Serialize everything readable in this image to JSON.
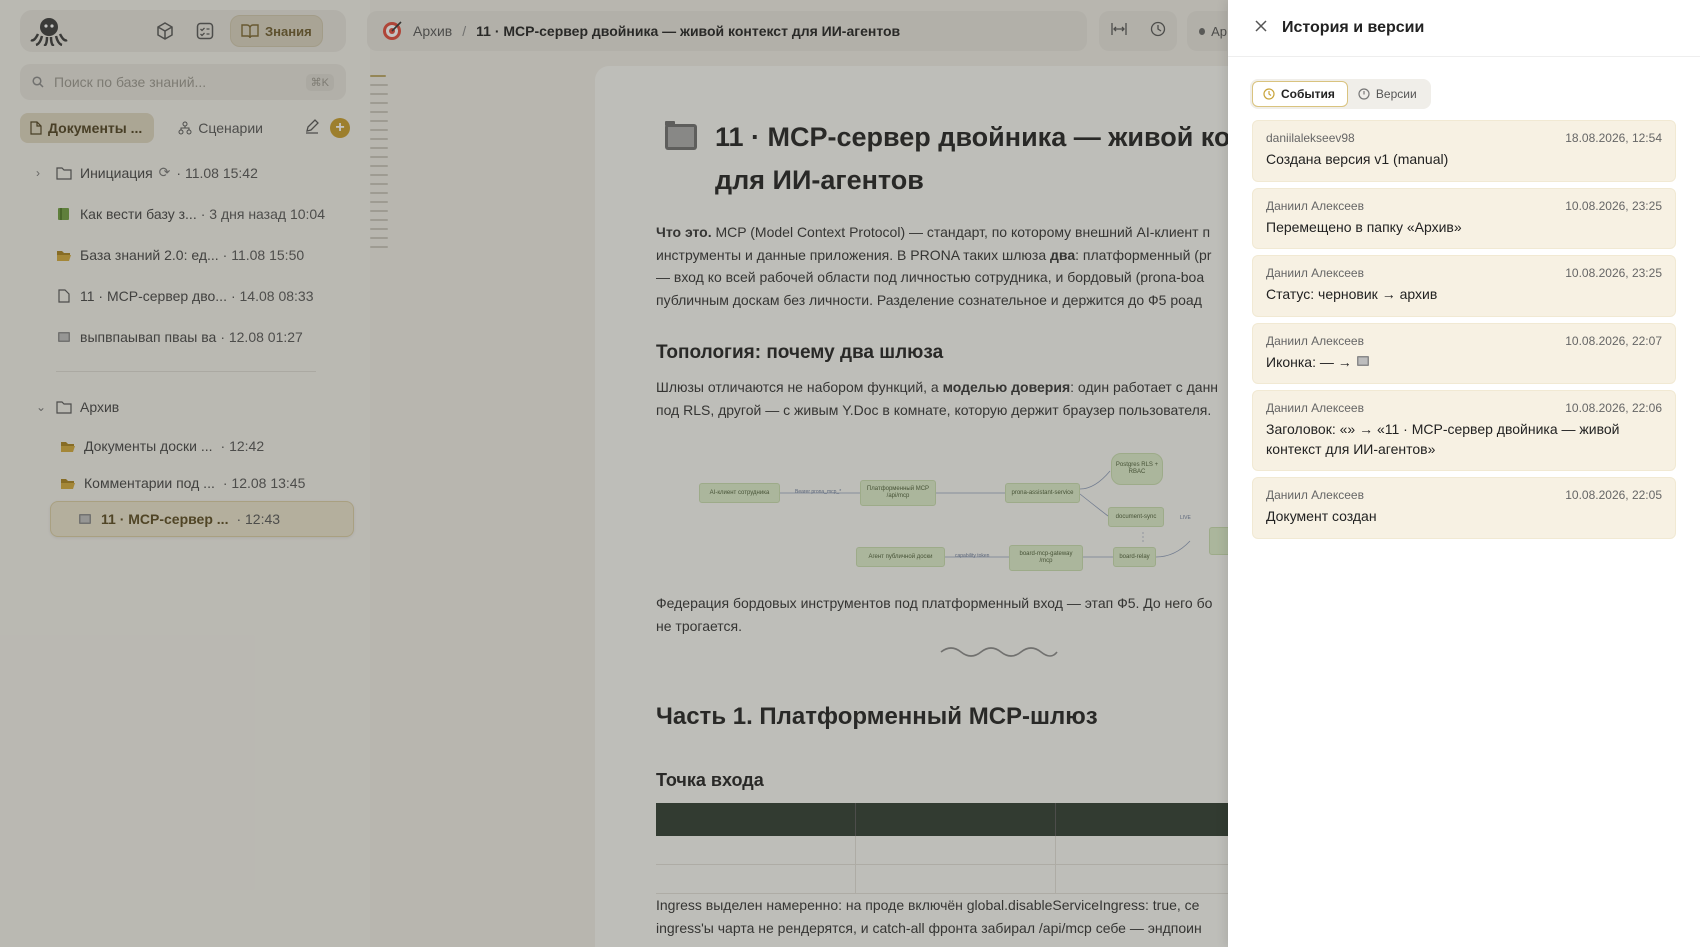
{
  "app": {
    "knowledge_label": "Знания",
    "search_placeholder": "Поиск по базе знаний...",
    "search_shortcut": "⌘K"
  },
  "sidebar": {
    "tab_docs": "Документы ...",
    "tab_scenarios": "Сценарии",
    "tree": [
      {
        "label": "Инициация",
        "meta": "· 11.08 15:42",
        "type": "folder"
      },
      {
        "label": "Как вести базу з...",
        "meta": "· 3 дня назад 10:04",
        "type": "book"
      },
      {
        "label": "База знаний 2.0: ед...",
        "meta": "· 11.08 15:50",
        "type": "folder-open"
      },
      {
        "label": "11 · MCP-сервер дво...",
        "meta": "· 14.08 08:33",
        "type": "doc"
      },
      {
        "label": "выпвпаывап пвaы ва",
        "meta": "· 12.08 01:27",
        "type": "board"
      }
    ],
    "archive": {
      "label": "Архив",
      "items": [
        {
          "label": "Документы доски ...",
          "meta": "· 12:42"
        },
        {
          "label": "Комментарии под ...",
          "meta": "· 12.08 13:45"
        },
        {
          "label": "11 · MCP-сервер ...",
          "meta": "· 12:43"
        }
      ]
    }
  },
  "breadcrumb": {
    "archive": "Архив",
    "separator": "/",
    "title": "11 · MCP-сервер двойника — живой контекст для ИИ-агентов"
  },
  "header_right": {
    "status_short": "Ар"
  },
  "document": {
    "title_line1": "11 · MCP-сервер двойника — живой ко",
    "title_line2": "для ИИ-агентов",
    "intro": {
      "bold": "Что это.",
      "line1": " MCP (Model Context Protocol) — стандарт, по которому внешний AI-клиент п",
      "line2a": "инструменты и данные приложения. В PRONA таких шлюза ",
      "line2bold": "два",
      "line2b": ": платформенный (pr",
      "line3": "— вход ко всей рабочей области под личностью сотрудника, и бордовый (prona-boa",
      "line4": "публичным доскам без личности. Разделение сознательное и держится до Ф5 роад"
    },
    "h_topology": "Топология: почему два шлюза",
    "topology": {
      "line1a": "Шлюзы отличаются не набором функций, а ",
      "line1bold": "моделью доверия",
      "line1b": ": один работает с данн",
      "line2": "под RLS, другой — с живым Y.Doc в комнате, которую держит браузер пользователя."
    },
    "diagram": {
      "n1": "AI-клиент сотрудника",
      "e1": "Bearer prona_mcp_*",
      "n2": "Платформенный MCP /api/mcp",
      "n3": "prona-assistant-service",
      "n4": "Postgres RLS + RBAC",
      "n5": "document-sync",
      "n6": "Агент публичной доски",
      "e2": "capability token",
      "n7": "board-mcp-gateway /mcp",
      "n8": "board-relay",
      "e3": "LIVE"
    },
    "federation_line1": "Федерация бордовых инструментов под платформенный вход — этап Ф5. До него бо",
    "federation_line2": "не трогается.",
    "h_part1": "Часть 1. Платформенный MCP-шлюз",
    "h_entry": "Точка входа",
    "ingress_line1": "Ingress выделен намеренно: на проде включён global.disableServiceIngress: true, се",
    "ingress_line2": "ingress'ы чарта не рендерятся, и catch-all фронта забирал /api/mcp себе — эндпоин"
  },
  "panel": {
    "title": "История и версии",
    "tab_events": "События",
    "tab_versions": "Версии",
    "events": [
      {
        "author": "daniilalekseev98",
        "date": "18.08.2026, 12:54",
        "text": "Создана версия v1 (manual)"
      },
      {
        "author": "Даниил Алексеев",
        "date": "10.08.2026, 23:25",
        "text": "Перемещено в папку «Архив»"
      },
      {
        "author": "Даниил Алексеев",
        "date": "10.08.2026, 23:25",
        "text": "Статус: черновик → архив"
      },
      {
        "author": "Даниил Алексеев",
        "date": "10.08.2026, 22:07",
        "text": "Иконка: — →"
      },
      {
        "author": "Даниил Алексеев",
        "date": "10.08.2026, 22:06",
        "text": "Заголовок: «» → «11 · MCP-сервер двойника — живой контекст для ИИ-агентов»"
      },
      {
        "author": "Даниил Алексеев",
        "date": "10.08.2026, 22:05",
        "text": "Документ создан"
      }
    ]
  },
  "colors": {
    "accent": "#c89d2a",
    "event_bg": "#f7f1e3",
    "table_head": "#2e3b30",
    "diagram_node": "#dcebc9"
  }
}
